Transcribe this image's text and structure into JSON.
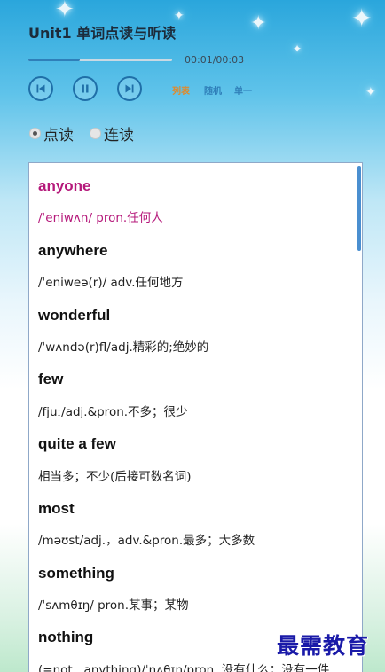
{
  "header": {
    "title": "Unit1 单词点读与听读",
    "time": "00:01/00:03",
    "progress": 0.36
  },
  "controls": {
    "prev_icon": "skip-previous-icon",
    "pause_icon": "pause-icon",
    "next_icon": "skip-next-icon",
    "accent_color": "#1f6fa8"
  },
  "modes": [
    {
      "label": "列表",
      "color": "#e08a2a"
    },
    {
      "label": "随机",
      "color": "#2f7fb9"
    },
    {
      "label": "单一",
      "color": "#2f7fb9"
    }
  ],
  "read_modes": [
    {
      "label": "点读",
      "selected": true
    },
    {
      "label": "连读",
      "selected": false
    }
  ],
  "highlight_color": "#b5187a",
  "entries": [
    {
      "word": "anyone",
      "def": "/ˈeniwʌn/  pron.任何人",
      "active": true
    },
    {
      "word": "anywhere",
      "def": "/ˈeniweə(r)/  adv.任何地方",
      "active": false
    },
    {
      "word": "wonderful",
      "def": "/ˈwʌndə(r)fl/adj.精彩的;绝妙的",
      "active": false
    },
    {
      "word": "few",
      "def": "/fjuː/adj.&pron.不多；很少",
      "active": false
    },
    {
      "word": "quite  a  few",
      "def": "相当多；不少(后接可数名词)",
      "active": false
    },
    {
      "word": "most",
      "def": "/məʊst/adj.，adv.&pron.最多；大多数",
      "active": false
    },
    {
      "word": "something",
      "def": "/ˈsʌmθɪŋ/  pron.某事；某物",
      "active": false
    },
    {
      "word": "nothing",
      "def": "(=not...anything)/ˈnʌθɪŋ/pron. 没有什么；没有一件",
      "active": false
    }
  ],
  "watermark": "最需教育"
}
